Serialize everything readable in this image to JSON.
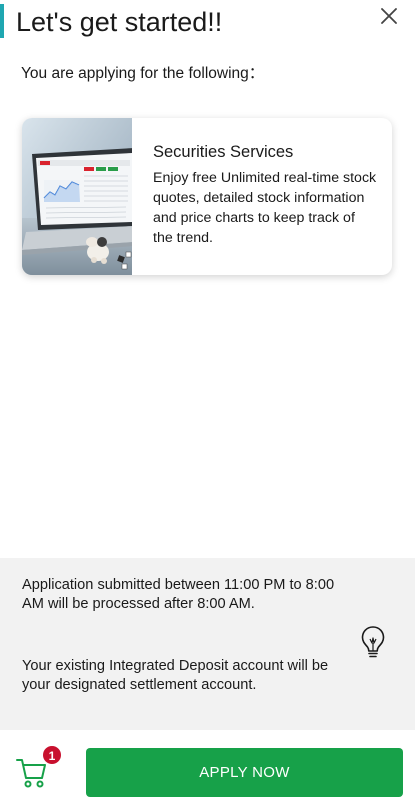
{
  "header": {
    "title": "Let's get started!!",
    "accent_color": "#1fa7b1",
    "close_icon": "close-icon"
  },
  "subtitle": "You are applying for the following：",
  "product_card": {
    "title": "Securities Services",
    "description": "Enjoy free Unlimited real-time stock quotes, detailed stock information and price charts to keep track of the trend.",
    "image": "laptop-with-stock-charts-image"
  },
  "info": {
    "processing_note": "Application submitted between 11:00 PM to 8:00 AM will be processed after 8:00 AM.",
    "settlement_note": "Your existing Integrated Deposit account will be your designated settlement account.",
    "icon": "lightbulb-icon"
  },
  "footer": {
    "cart_icon": "cart-icon",
    "cart_count": "1",
    "apply_label": "APPLY NOW",
    "apply_color": "#17a149",
    "badge_color": "#c8102e"
  }
}
